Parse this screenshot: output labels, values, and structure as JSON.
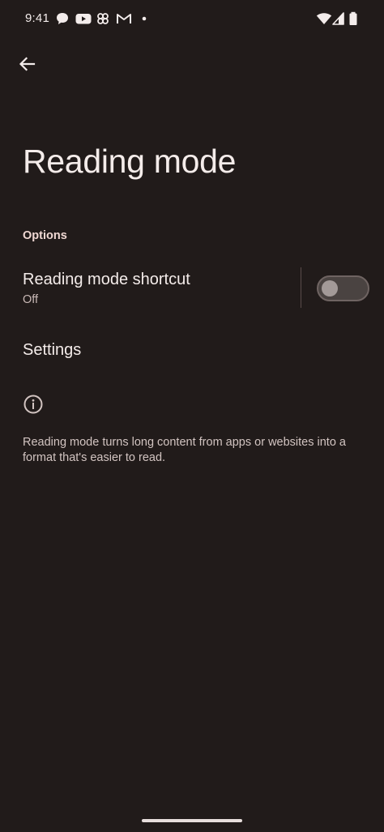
{
  "status_bar": {
    "time": "9:41",
    "notification_icons": [
      "chat-bubble-icon",
      "youtube-icon",
      "pinwheel-icon",
      "gmail-icon",
      "dot-icon"
    ],
    "system_icons": [
      "wifi-icon",
      "cellular-signal-icon",
      "battery-icon"
    ]
  },
  "header": {
    "back_icon": "arrow-back-icon",
    "title": "Reading mode"
  },
  "options": {
    "section_label": "Options",
    "shortcut": {
      "title": "Reading mode shortcut",
      "subtitle": "Off",
      "enabled": false
    },
    "settings_label": "Settings"
  },
  "info": {
    "icon": "info-icon",
    "text": "Reading mode turns long content from apps or websites into a format that's easier to read."
  },
  "colors": {
    "background": "#211b1a",
    "text_primary": "#f4ecea",
    "section_accent": "#f0d8d3",
    "toggle_track_off": "#4a4341"
  }
}
